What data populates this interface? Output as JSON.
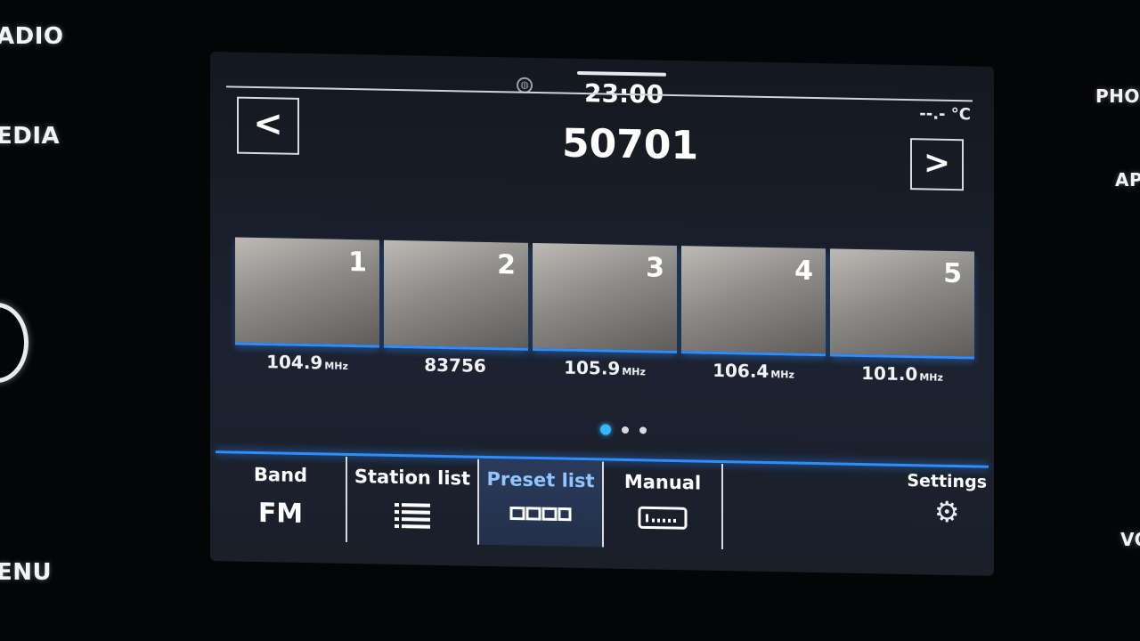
{
  "hardware": {
    "left": [
      "ADIO",
      "EDIA",
      "ENU"
    ],
    "right": [
      "PHON",
      "AP",
      "VO"
    ]
  },
  "status": {
    "time": "23:00",
    "temperature": "--.- °C"
  },
  "station": {
    "frequency": "50701",
    "prev_label": "<",
    "next_label": ">"
  },
  "presets": [
    {
      "number": "1",
      "label": "104.9",
      "unit": "MHz"
    },
    {
      "number": "2",
      "label": "83756",
      "unit": ""
    },
    {
      "number": "3",
      "label": "105.9",
      "unit": "MHz"
    },
    {
      "number": "4",
      "label": "106.4",
      "unit": "MHz"
    },
    {
      "number": "5",
      "label": "101.0",
      "unit": "MHz"
    }
  ],
  "pager": {
    "pages": 3,
    "current": 1
  },
  "tabs": {
    "band_label": "Band",
    "band_value": "FM",
    "station_list": "Station list",
    "preset_list": "Preset list",
    "manual": "Manual",
    "settings": "Settings"
  },
  "icons": {
    "globe": "globe-icon",
    "list": "list-icon",
    "preset": "preset-list-icon",
    "manual": "manual-tuner-icon",
    "settings": "gear-icon"
  },
  "colors": {
    "accent": "#2e8cff",
    "active_dot": "#35b6ff",
    "active_tab_text": "#8fc6ff"
  }
}
